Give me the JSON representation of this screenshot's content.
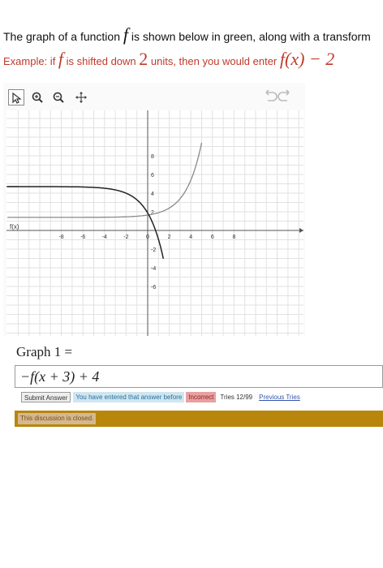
{
  "intro": {
    "text_before": "The graph of a function ",
    "fn": "f",
    "text_after": " is shown below in green, along with a transform"
  },
  "example": {
    "prefix": "Example: if ",
    "fn": "f",
    "middle": " is shifted down ",
    "amount": "2",
    "suffix": " units, then you would enter ",
    "expr": "f(x) − 2"
  },
  "toolbar": {
    "tools": [
      "pointer-icon",
      "zoom-in-icon",
      "zoom-out-icon",
      "pan-icon"
    ],
    "undo_icon": "undo-redo-icon"
  },
  "graph": {
    "fx_label": "f(x)",
    "x_ticks": [
      "-8",
      "-6",
      "-4",
      "-2",
      "0",
      "2",
      "4",
      "6",
      "8"
    ],
    "y_ticks": [
      "8",
      "6",
      "4",
      "2",
      "-2",
      "-4",
      "-6"
    ],
    "curve_color": "#8a8a8a",
    "asymptote_color": "#333333"
  },
  "answer": {
    "label": "Graph 1 =",
    "value": "−f(x + 3) + 4"
  },
  "status": {
    "submit_label": "Submit Answer",
    "entered_msg": "You have entered that answer before",
    "incorrect_label": "Incorrect",
    "tries": "Tries 12/99",
    "previous_tries": "Previous Tries"
  },
  "discussion": {
    "text": "This discussion is closed."
  }
}
